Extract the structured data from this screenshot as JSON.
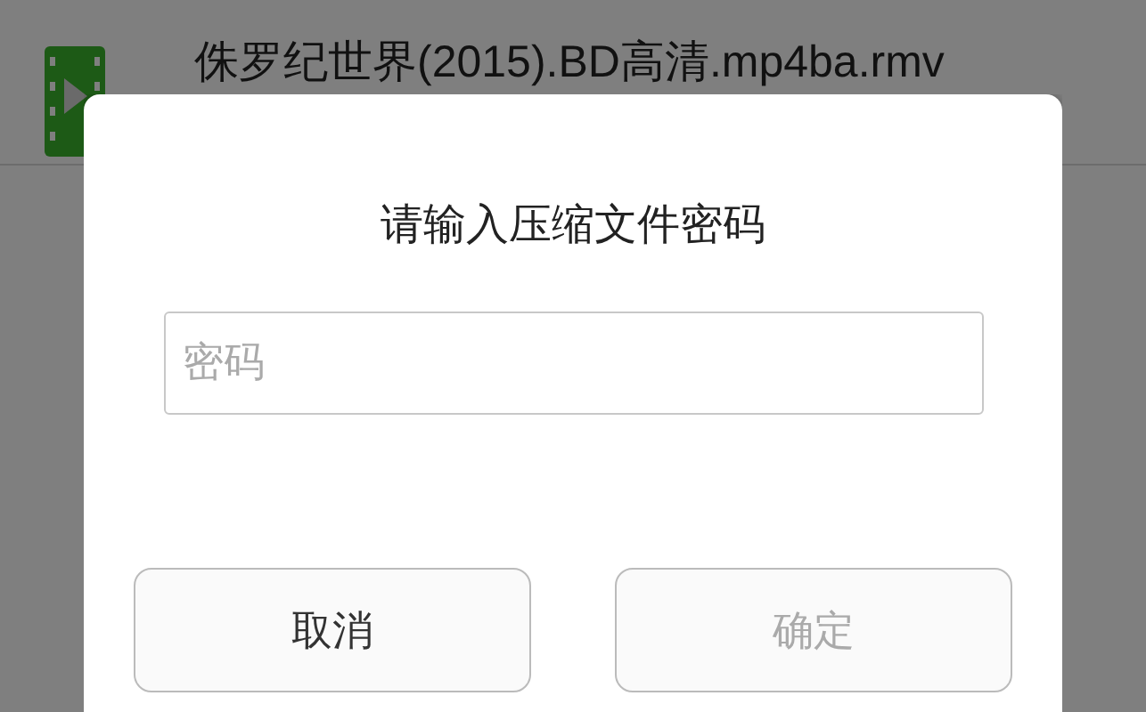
{
  "file_list": {
    "items": [
      {
        "name": "侏罗纪世界(2015).BD高清.mp4ba.rmv"
      }
    ]
  },
  "dialog": {
    "title": "请输入压缩文件密码",
    "password_field": {
      "placeholder": "密码"
    },
    "buttons": [
      {
        "label": "取消",
        "disabled": false
      },
      {
        "label": "确定",
        "disabled": true
      }
    ]
  }
}
